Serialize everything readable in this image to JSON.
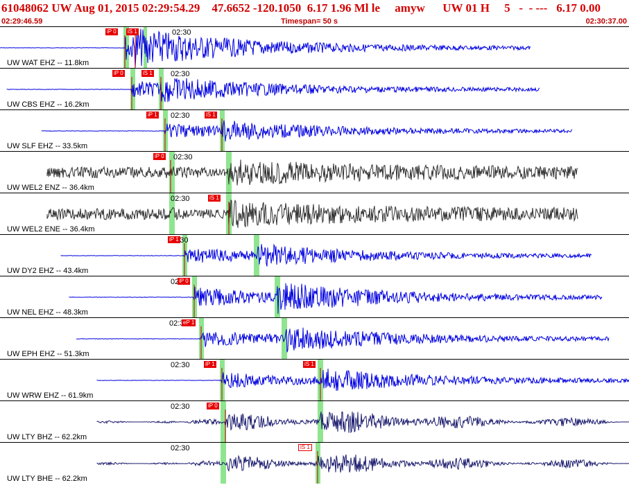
{
  "header": {
    "title": "61048062 UW Aug 01, 2015 02:29:54.29    47.6652 -120.1050  6.17 1.96 Ml le     amyw      UW 01 H     5   -  - ---   6.17 0.00",
    "start_time": "02:29:46.59",
    "timespan": "Timespan=  50 s",
    "end_time": "02:30:37.00"
  },
  "colors": {
    "header_text": "#d40000",
    "blue_trace": "#0000e0",
    "gray_trace": "#303030",
    "navy_trace": "#1a1a6e",
    "pick": "#e80000",
    "pick_window": "#8fe58f"
  },
  "time_mark": "02:30",
  "traces": [
    {
      "label": "UW WAT EHZ -- 11.8km",
      "color": "blue",
      "picks": [
        "iP 0",
        "iS 1"
      ]
    },
    {
      "label": "UW CBS EHZ -- 16.2km",
      "color": "blue",
      "picks": [
        "iP 0",
        "iS 1"
      ]
    },
    {
      "label": "UW SLF EHZ -- 33.5km",
      "color": "blue",
      "picks": [
        "iP 1",
        "iS 1"
      ]
    },
    {
      "label": "UW WEL2 ENZ -- 36.4km",
      "color": "gray",
      "picks": [
        "iP 0"
      ]
    },
    {
      "label": "UW WEL2 ENE -- 36.4km",
      "color": "gray",
      "picks": [
        "iS 1"
      ]
    },
    {
      "label": "UW DY2 EHZ -- 43.4km",
      "color": "blue",
      "picks": [
        "iP 1"
      ]
    },
    {
      "label": "UW NEL EHZ -- 48.3km",
      "color": "blue",
      "picks": [
        "iP 0"
      ]
    },
    {
      "label": "UW EPH EHZ -- 51.3km",
      "color": "blue",
      "picks": [
        "eP 1"
      ]
    },
    {
      "label": "UW WRW EHZ -- 61.9km",
      "color": "blue",
      "picks": [
        "iP 1",
        "iS 1"
      ]
    },
    {
      "label": "UW LTY BHZ -- 62.2km",
      "color": "navy",
      "picks": [
        "iP 0"
      ]
    },
    {
      "label": "UW LTY BHE -- 62.2km",
      "color": "navy",
      "picks": [
        "iS 1"
      ]
    }
  ]
}
